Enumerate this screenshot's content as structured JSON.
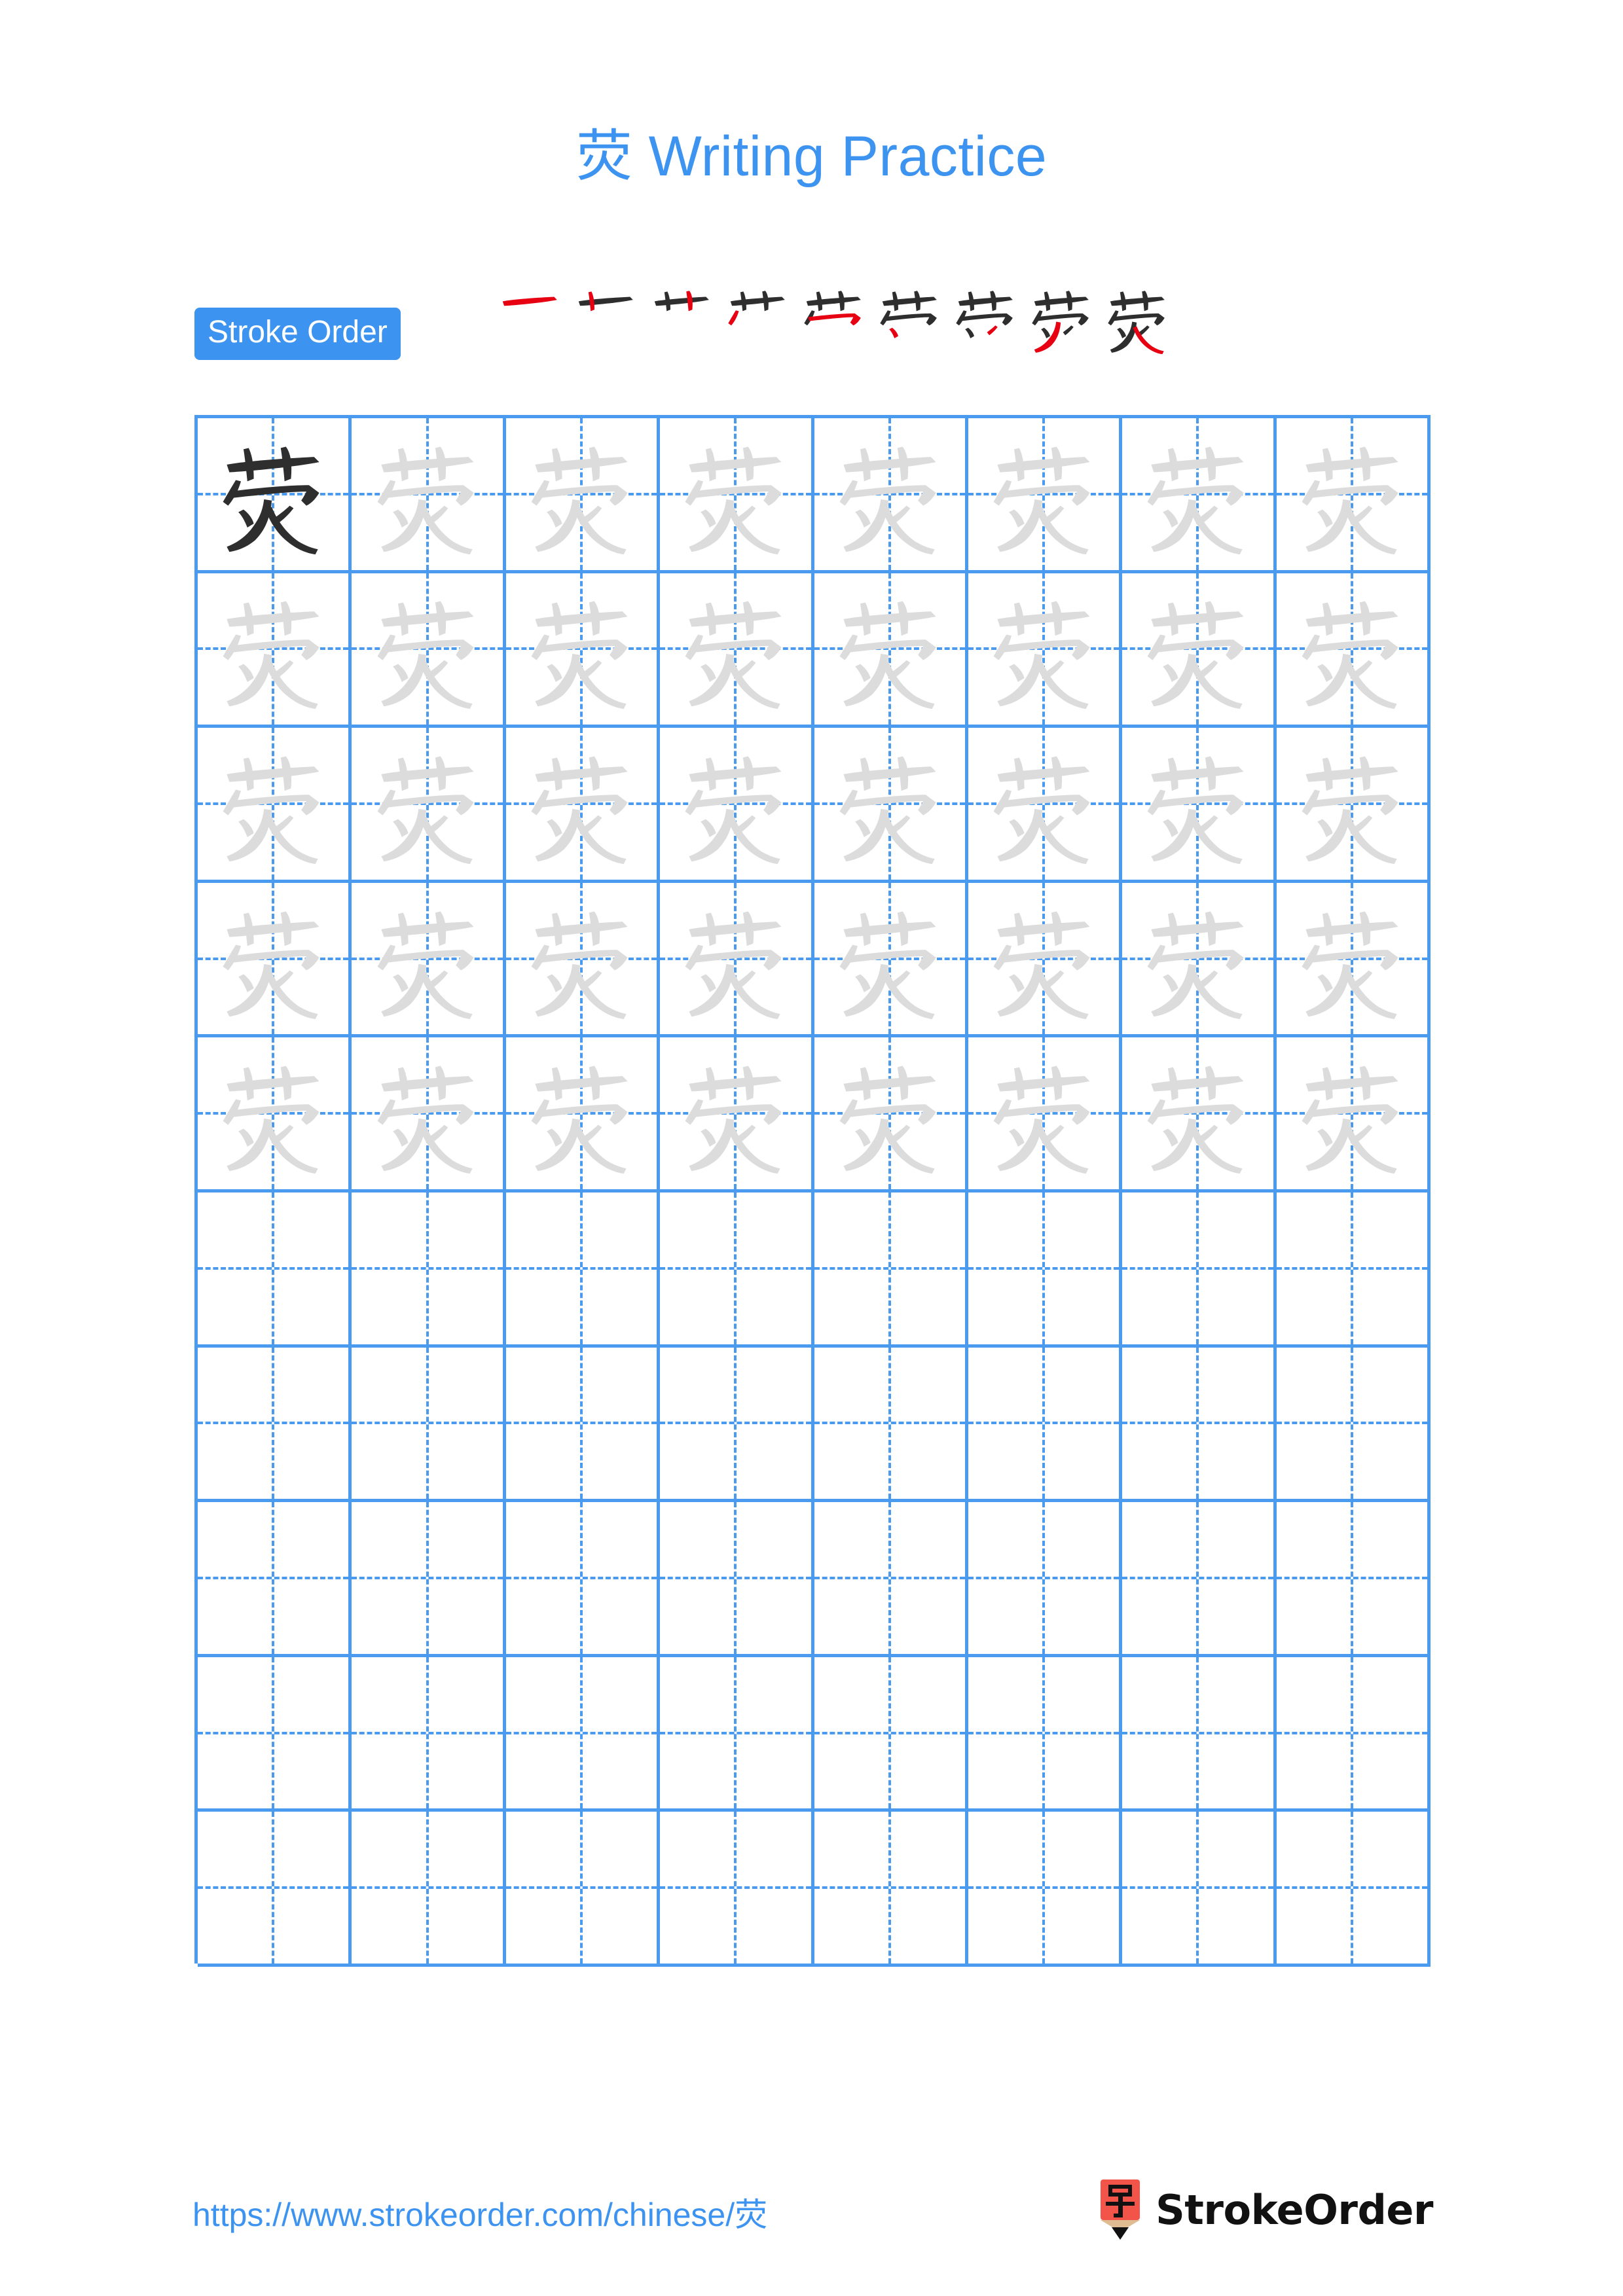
{
  "page": {
    "character": "荧",
    "title": "荧 Writing Practice",
    "background_color": "#ffffff",
    "accent_color": "#3d93f0",
    "grid_line_color": "#4a9bf0",
    "trace_color": "#dcdcdc",
    "solid_char_color": "#2e2e2e",
    "new_stroke_color": "#e60012"
  },
  "stroke_order": {
    "badge_label": "Stroke Order",
    "badge_background": "#3d93f0",
    "badge_text_color": "#ffffff",
    "total_strokes": 9,
    "steps": [
      {
        "index": 1,
        "partial": "一",
        "new_stroke": "heng"
      },
      {
        "index": 2,
        "partial": "十",
        "new_stroke": "shu"
      },
      {
        "index": 3,
        "partial": "艹",
        "new_stroke": "shu"
      },
      {
        "index": 4,
        "partial": "艹丿",
        "new_stroke": "pie"
      },
      {
        "index": 5,
        "partial": "芦",
        "new_stroke": "heng-zhe"
      },
      {
        "index": 6,
        "partial": "芦",
        "new_stroke": "dian"
      },
      {
        "index": 7,
        "partial": "艼",
        "new_stroke": "dian"
      },
      {
        "index": 8,
        "partial": "荗",
        "new_stroke": "pie"
      },
      {
        "index": 9,
        "partial": "荧",
        "new_stroke": "na"
      }
    ]
  },
  "practice_grid": {
    "columns": 8,
    "rows": 10,
    "filled_rows": 5,
    "empty_rows": 5,
    "cell_style": "mizige",
    "rows_data": [
      [
        "solid",
        "trace",
        "trace",
        "trace",
        "trace",
        "trace",
        "trace",
        "trace"
      ],
      [
        "trace",
        "trace",
        "trace",
        "trace",
        "trace",
        "trace",
        "trace",
        "trace"
      ],
      [
        "trace",
        "trace",
        "trace",
        "trace",
        "trace",
        "trace",
        "trace",
        "trace"
      ],
      [
        "trace",
        "trace",
        "trace",
        "trace",
        "trace",
        "trace",
        "trace",
        "trace"
      ],
      [
        "trace",
        "trace",
        "trace",
        "trace",
        "trace",
        "trace",
        "trace",
        "trace"
      ],
      [
        "empty",
        "empty",
        "empty",
        "empty",
        "empty",
        "empty",
        "empty",
        "empty"
      ],
      [
        "empty",
        "empty",
        "empty",
        "empty",
        "empty",
        "empty",
        "empty",
        "empty"
      ],
      [
        "empty",
        "empty",
        "empty",
        "empty",
        "empty",
        "empty",
        "empty",
        "empty"
      ],
      [
        "empty",
        "empty",
        "empty",
        "empty",
        "empty",
        "empty",
        "empty",
        "empty"
      ],
      [
        "empty",
        "empty",
        "empty",
        "empty",
        "empty",
        "empty",
        "empty",
        "empty"
      ]
    ]
  },
  "footer": {
    "url": "https://www.strokeorder.com/chinese/荧",
    "brand_name": "StrokeOrder",
    "logo_character": "字",
    "logo_body_color": "#f2544a",
    "logo_wood_color": "#e0bc92",
    "logo_tip_color": "#111111"
  }
}
